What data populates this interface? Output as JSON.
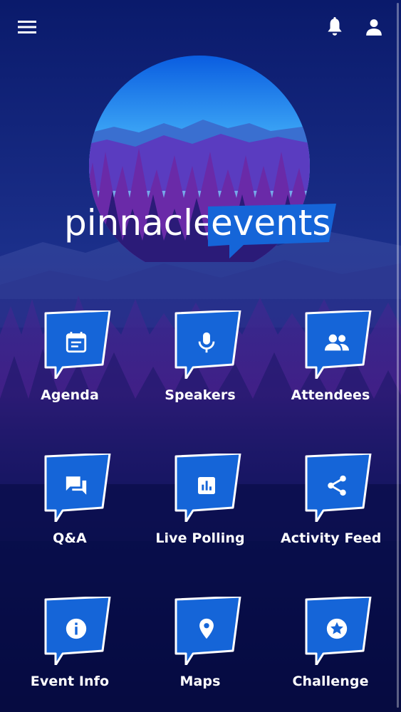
{
  "header": {
    "menu_icon": "hamburger-menu-icon",
    "notifications_icon": "bell-icon",
    "profile_icon": "person-icon"
  },
  "brand": {
    "name_part1": "pinnacle",
    "name_part2": "events",
    "accent_color": "#1565d8"
  },
  "grid": {
    "tiles": [
      {
        "label": "Agenda",
        "icon": "calendar-icon"
      },
      {
        "label": "Speakers",
        "icon": "microphone-icon"
      },
      {
        "label": "Attendees",
        "icon": "people-icon"
      },
      {
        "label": "Q&A",
        "icon": "chat-bubbles-icon"
      },
      {
        "label": "Live Polling",
        "icon": "bar-chart-icon"
      },
      {
        "label": "Activity Feed",
        "icon": "share-icon"
      },
      {
        "label": "Event Info",
        "icon": "info-icon"
      },
      {
        "label": "Maps",
        "icon": "map-pin-icon"
      },
      {
        "label": "Challenge",
        "icon": "star-badge-icon"
      }
    ]
  },
  "colors": {
    "background": "#07104a",
    "tile": "#1565d8",
    "tile_border": "#ffffff"
  }
}
